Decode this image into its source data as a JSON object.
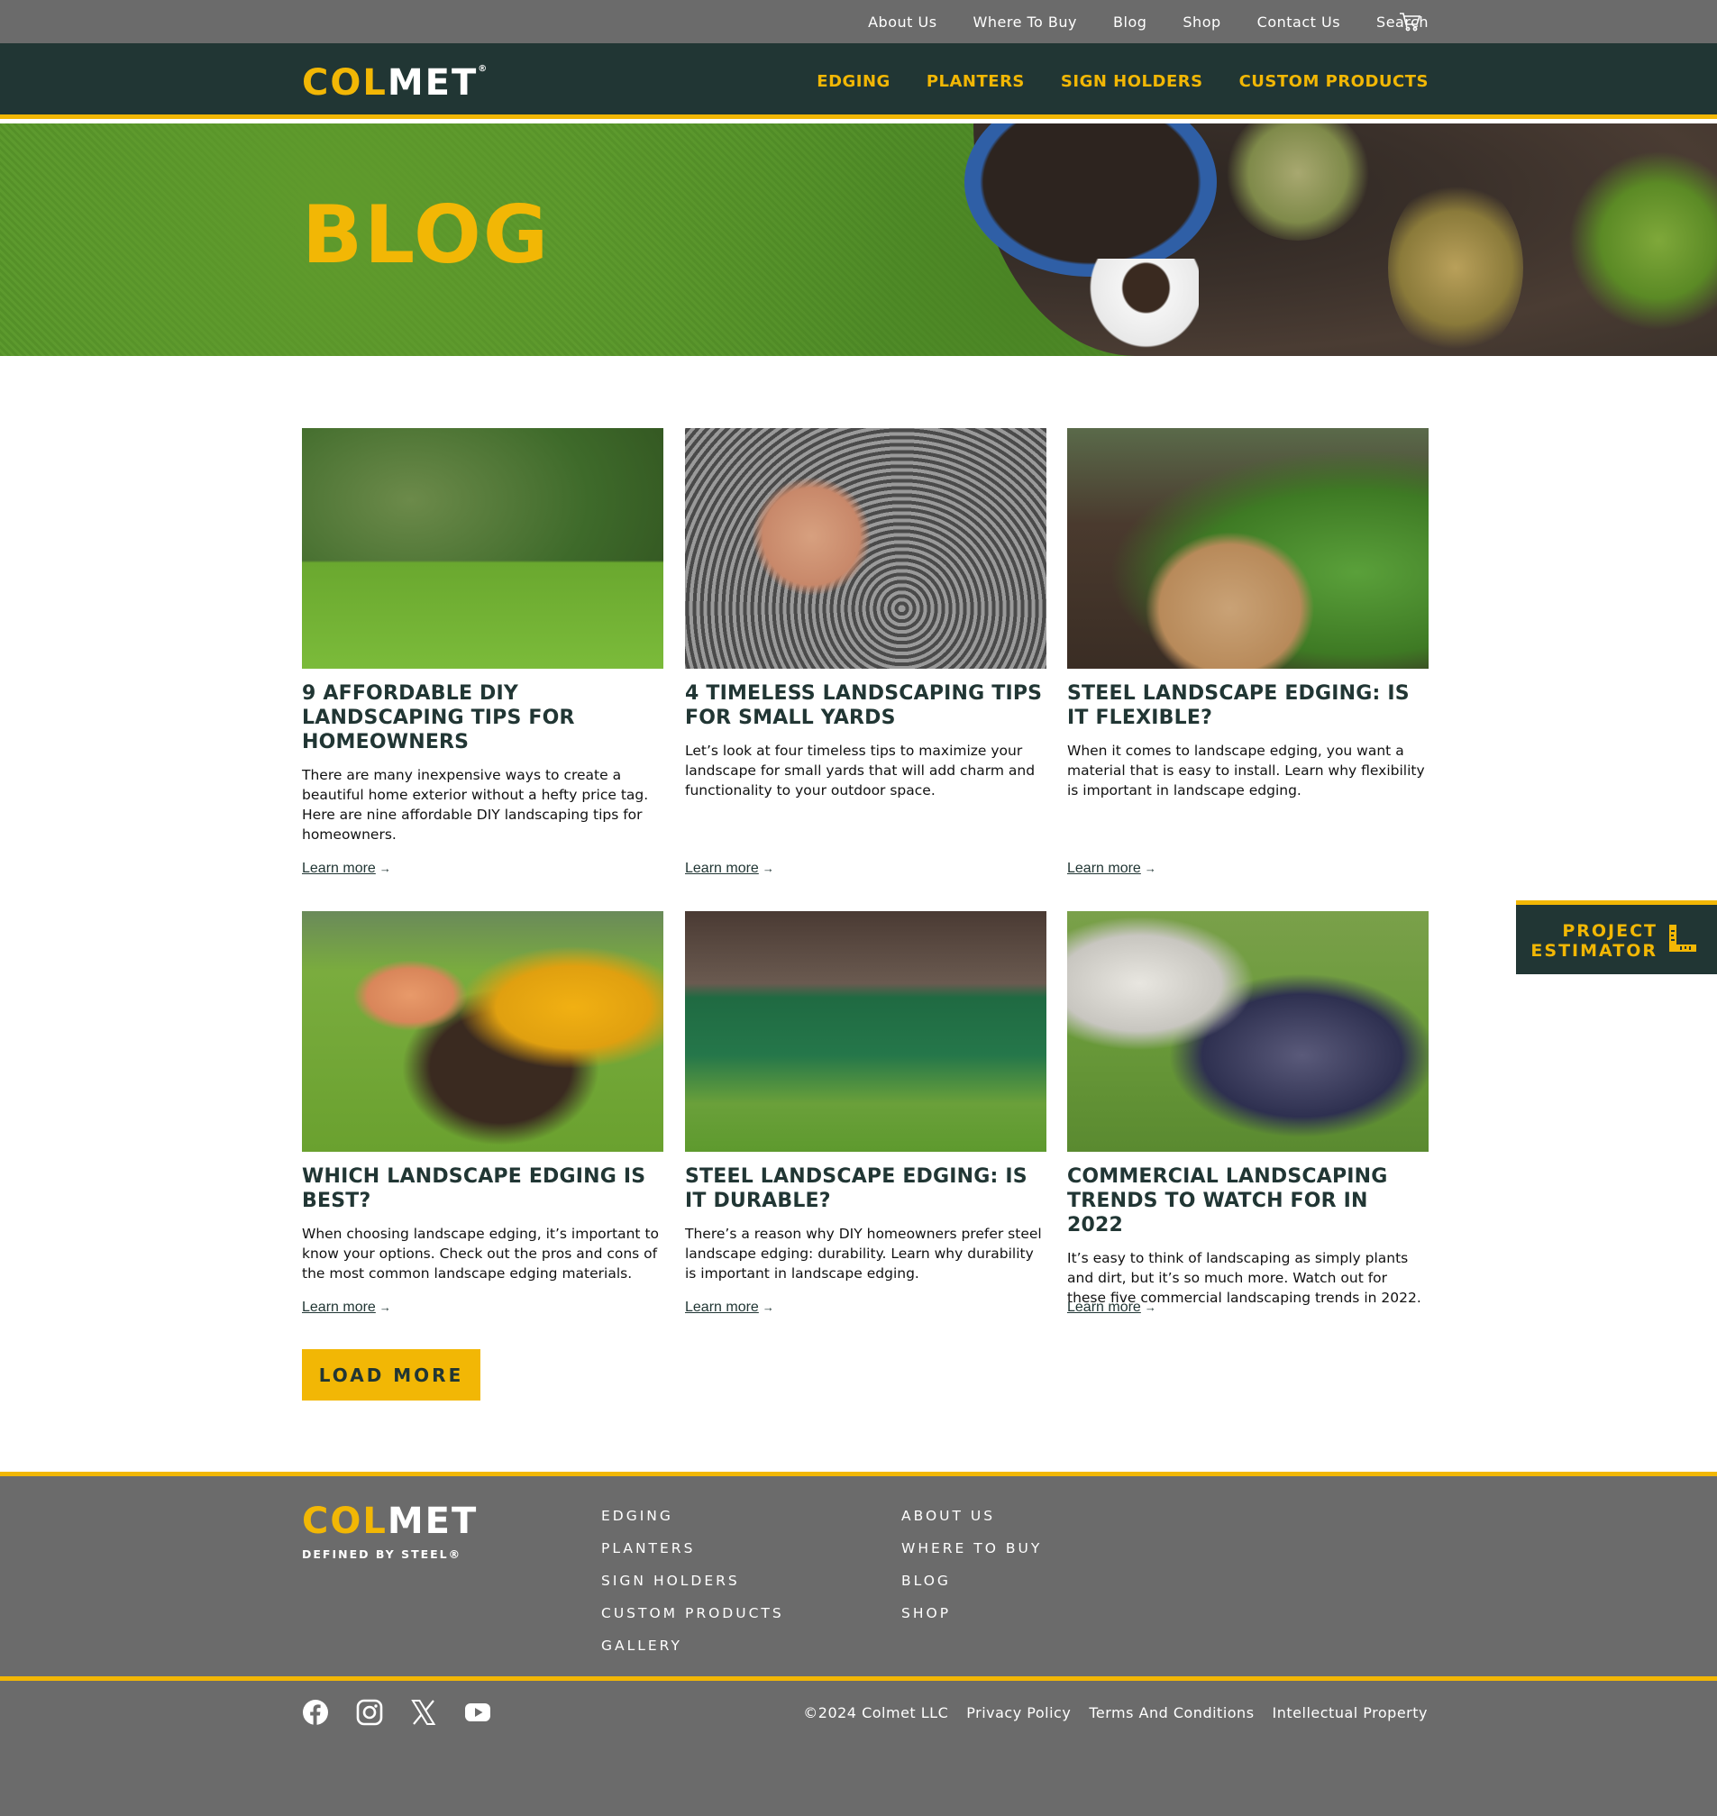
{
  "util_nav": {
    "items": [
      "About Us",
      "Where To Buy",
      "Blog",
      "Shop",
      "Contact Us",
      "Search"
    ],
    "cart_icon": "cart-icon"
  },
  "header": {
    "logo_col": "COL",
    "logo_met": "MET",
    "logo_mark": "®",
    "nav": [
      "EDGING",
      "PLANTERS",
      "SIGN HOLDERS",
      "CUSTOM PRODUCTS"
    ]
  },
  "hero": {
    "title": "BLOG"
  },
  "posts": [
    {
      "title": "9 Affordable DIY Landscaping Tips For Homeowners",
      "description": "There are many inexpensive ways to create a beautiful home exterior without a hefty price tag. Here are nine affordable DIY landscaping tips for homeowners.",
      "link": "Learn more"
    },
    {
      "title": "4 Timeless Landscaping Tips For Small Yards",
      "description": "Let’s look at four timeless tips to maximize your landscape for small yards that will add charm and functionality to your outdoor space.",
      "link": "Learn more"
    },
    {
      "title": "Steel Landscape Edging: Is It Flexible?",
      "description": "When it comes to landscape edging, you want a material that is easy to install. Learn why flexibility is important in landscape edging.",
      "link": "Learn more"
    },
    {
      "title": "Which Landscape Edging Is Best?",
      "description": "When choosing landscape edging, it’s important to know your options. Check out the pros and cons of the most common landscape edging materials.",
      "link": "Learn more"
    },
    {
      "title": "Steel Landscape Edging: Is It Durable?",
      "description": "There’s a reason why DIY homeowners prefer steel landscape edging: durability. Learn why durability is important in landscape edging.",
      "link": "Learn more"
    },
    {
      "title": "Commercial Landscaping Trends To Watch For In 2022",
      "description": "It’s easy to think of landscaping as simply plants and dirt, but it’s so much more. Watch out for these five commercial landscaping trends in 2022.",
      "link": "Learn more"
    }
  ],
  "load_more": "LOAD MORE",
  "estimator": {
    "line1": "PROJECT",
    "line2": "ESTIMATOR",
    "icon": "ruler-icon"
  },
  "footer": {
    "logo_col": "COL",
    "logo_met": "MET",
    "tagline": "DEFINED BY STEEL®",
    "products": [
      "EDGING",
      "PLANTERS",
      "SIGN HOLDERS",
      "CUSTOM PRODUCTS",
      "GALLERY"
    ],
    "company": [
      "ABOUT US",
      "WHERE TO BUY",
      "BLOG",
      "SHOP"
    ],
    "social_icons": [
      "facebook-icon",
      "instagram-icon",
      "x-icon",
      "youtube-icon"
    ],
    "copyright": "©2024 Colmet LLC",
    "legal": [
      "Privacy Policy",
      "Terms And Conditions",
      "Intellectual Property"
    ]
  },
  "colors": {
    "brand_yellow": "#f2b705",
    "brand_dark": "#213634",
    "util_gray": "#6b6b6b"
  }
}
